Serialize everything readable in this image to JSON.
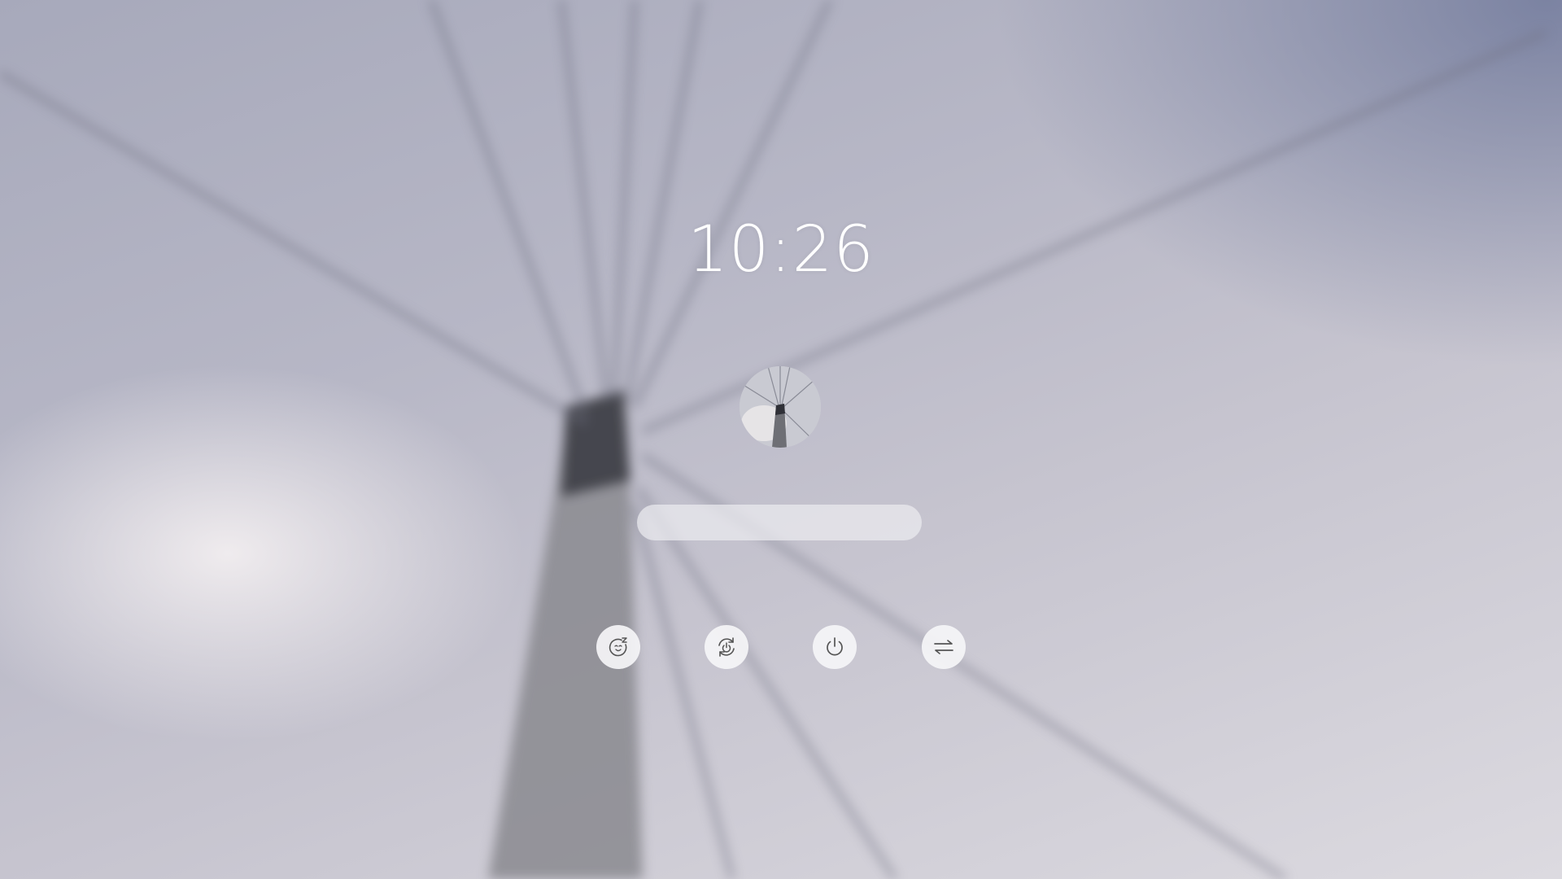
{
  "lockscreen": {
    "clock": {
      "time": "10:26"
    },
    "user": {
      "avatar_icon": "user-avatar-image"
    },
    "password": {
      "value": "",
      "placeholder": ""
    },
    "actions": [
      {
        "id": "suspend",
        "icon": "suspend-icon"
      },
      {
        "id": "hibernate",
        "icon": "hibernate-icon"
      },
      {
        "id": "shutdown",
        "icon": "power-icon"
      },
      {
        "id": "switch-user",
        "icon": "switch-user-icon"
      }
    ]
  }
}
